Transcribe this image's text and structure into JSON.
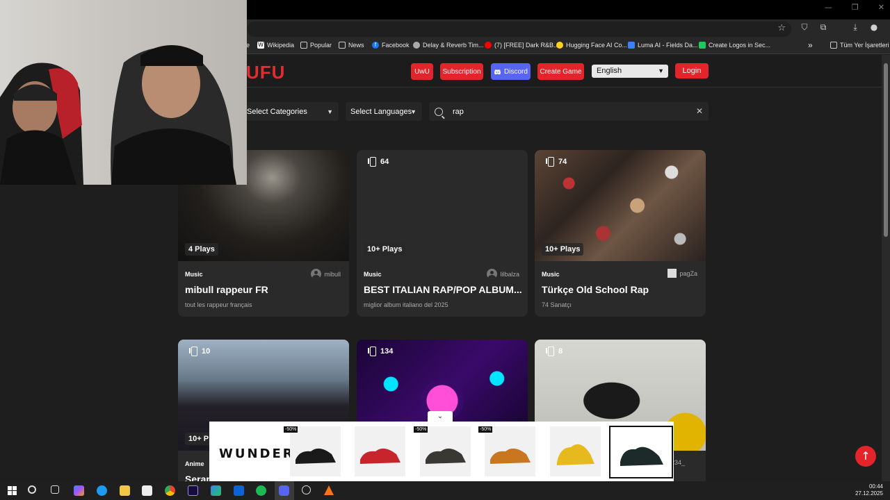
{
  "browser": {
    "bookmarks": [
      {
        "label": "e",
        "color": "#282828"
      },
      {
        "label": "Wikipedia",
        "color": "#ffffff"
      },
      {
        "label": "Popular",
        "color": "#282828"
      },
      {
        "label": "News",
        "color": "#282828"
      },
      {
        "label": "Facebook",
        "color": "#1877f2"
      },
      {
        "label": "Delay & Reverb Tim...",
        "color": "#888888"
      },
      {
        "label": "(7) [FREE] Dark R&B...",
        "color": "#ff0000"
      },
      {
        "label": "Hugging Face AI Co...",
        "color": "#ffd21e"
      },
      {
        "label": "Luma AI - Fields Da...",
        "color": "#3b82f6"
      },
      {
        "label": "Create Logos in Sec...",
        "color": "#22c55e"
      }
    ],
    "more_bookmarks_label": "»",
    "all_bookmarks_label": "Tüm Yer İşaretleri"
  },
  "site": {
    "logo": "UFU",
    "buttons": {
      "uwu": "UwU",
      "subscription": "Subscription",
      "discord": "Discord",
      "create_game": "Create Game",
      "login": "Login"
    },
    "language": "English"
  },
  "filters": {
    "categories": "Select Categories",
    "languages": "Select Languages",
    "search_value": "rap"
  },
  "cards": [
    {
      "count": "",
      "plays": "4 Plays",
      "category": "Music",
      "author": "mibull",
      "title": "mibull rappeur FR",
      "subtitle": "tout les rappeur français"
    },
    {
      "count": "64",
      "plays": "10+ Plays",
      "category": "Music",
      "author": "lilbalza",
      "title": "BEST ITALIAN RAP/POP ALBUM...",
      "subtitle": "miglior album italiano del 2025"
    },
    {
      "count": "74",
      "plays": "10+ Plays",
      "category": "Music",
      "author": "pagZa",
      "title": "Türkçe Old School Rap",
      "subtitle": "74 Sanatçı"
    },
    {
      "count": "10",
      "plays": "10+ P",
      "category": "Anime",
      "author": "",
      "title": "Serap",
      "subtitle": ""
    },
    {
      "count": "134",
      "plays": "",
      "category": "",
      "author": "",
      "title": "",
      "subtitle": ""
    },
    {
      "count": "8",
      "plays": "",
      "category": "",
      "author": "01234_",
      "title": "",
      "subtitle": ""
    }
  ],
  "ad": {
    "brand": "WUNDER",
    "sale_label": "-50%",
    "toggle_icon": "chevron-down-icon"
  },
  "taskbar": {
    "time": "00:44",
    "date": "27.12.2025"
  }
}
